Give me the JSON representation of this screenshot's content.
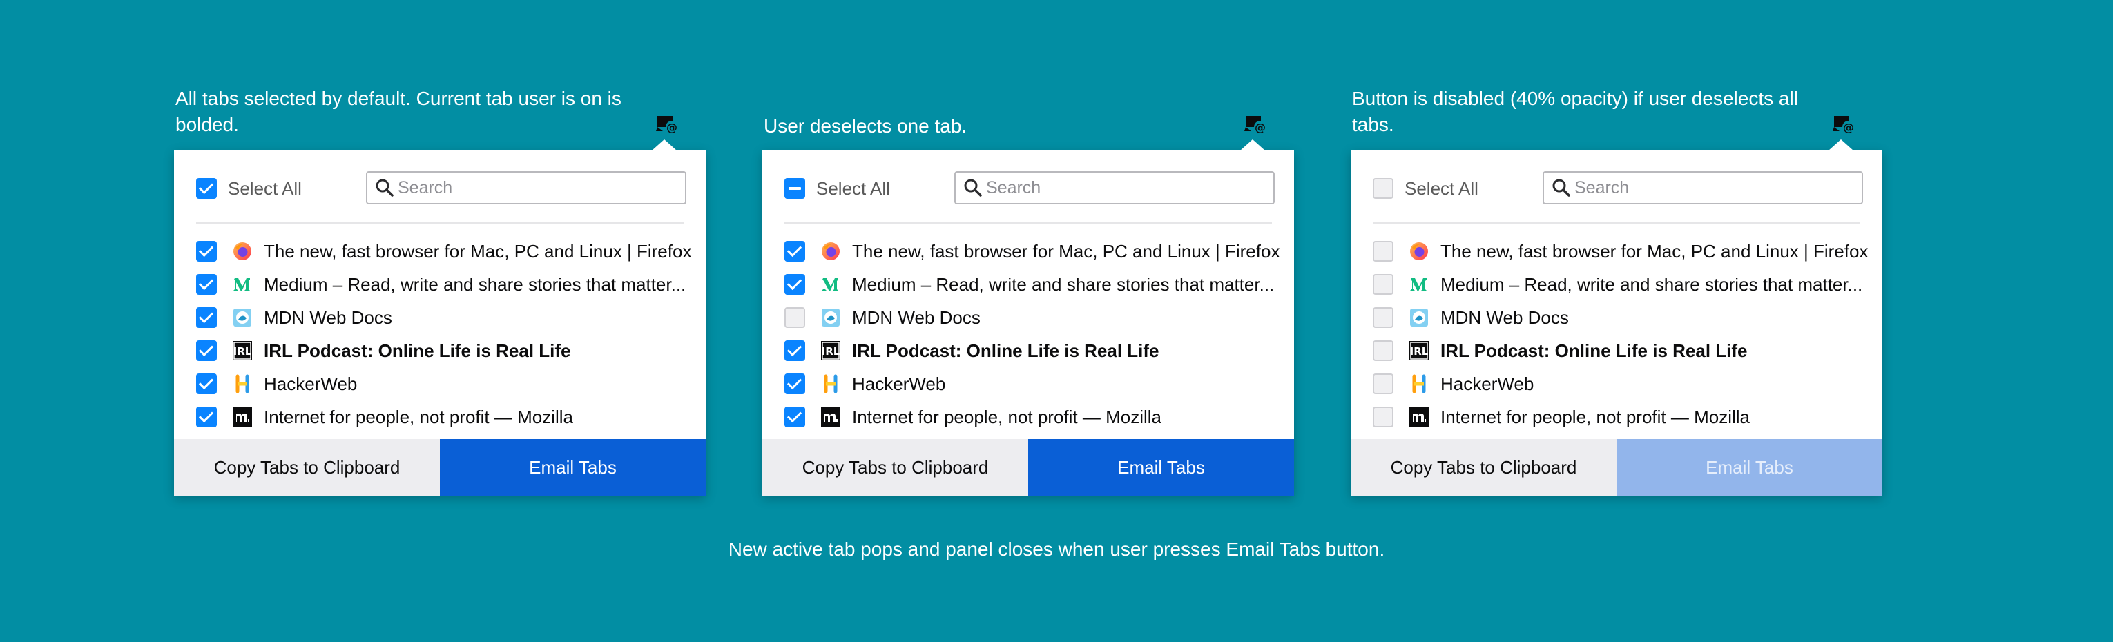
{
  "colors": {
    "background": "#028ea3",
    "accent_blue": "#0a84ff",
    "email_button": "#0a5fd6",
    "email_button_disabled": "#92b5eb"
  },
  "icons": {
    "toolbar": "email-tabs-icon",
    "search": "search-icon",
    "favicons": [
      "firefox-icon",
      "medium-icon",
      "mdn-icon",
      "irl-icon",
      "hackerweb-icon",
      "mozilla-icon"
    ]
  },
  "panels": [
    {
      "caption": "All tabs selected by default. Current tab user is on is bolded.",
      "select_all_label": "Select All",
      "select_all_state": "checked",
      "search_placeholder": "Search",
      "tabs": [
        {
          "title": "The new, fast browser for Mac, PC and Linux | Firefox",
          "checked": true,
          "bold": false
        },
        {
          "title": "Medium – Read, write and share stories that matter...",
          "checked": true,
          "bold": false
        },
        {
          "title": "MDN Web Docs",
          "checked": true,
          "bold": false
        },
        {
          "title": "IRL Podcast: Online Life is Real Life",
          "checked": true,
          "bold": true
        },
        {
          "title": "HackerWeb",
          "checked": true,
          "bold": false
        },
        {
          "title": "Internet for people, not profit — Mozilla",
          "checked": true,
          "bold": false
        }
      ],
      "copy_label": "Copy Tabs to Clipboard",
      "email_label": "Email Tabs",
      "email_disabled": false
    },
    {
      "caption": "User deselects one tab.",
      "select_all_label": "Select All",
      "select_all_state": "indeterminate",
      "search_placeholder": "Search",
      "tabs": [
        {
          "title": "The new, fast browser for Mac, PC and Linux | Firefox",
          "checked": true,
          "bold": false
        },
        {
          "title": "Medium – Read, write and share stories that matter...",
          "checked": true,
          "bold": false
        },
        {
          "title": "MDN Web Docs",
          "checked": false,
          "bold": false
        },
        {
          "title": "IRL Podcast: Online Life is Real Life",
          "checked": true,
          "bold": true
        },
        {
          "title": "HackerWeb",
          "checked": true,
          "bold": false
        },
        {
          "title": "Internet for people, not profit — Mozilla",
          "checked": true,
          "bold": false
        }
      ],
      "copy_label": "Copy Tabs to Clipboard",
      "email_label": "Email Tabs",
      "email_disabled": false
    },
    {
      "caption": "Button is disabled (40% opacity) if user deselects all tabs.",
      "select_all_label": "Select All",
      "select_all_state": "unchecked",
      "search_placeholder": "Search",
      "tabs": [
        {
          "title": "The new, fast browser for Mac, PC and Linux | Firefox",
          "checked": false,
          "bold": false
        },
        {
          "title": "Medium – Read, write and share stories that matter...",
          "checked": false,
          "bold": false
        },
        {
          "title": "MDN Web Docs",
          "checked": false,
          "bold": false
        },
        {
          "title": "IRL Podcast: Online Life is Real Life",
          "checked": false,
          "bold": true
        },
        {
          "title": "HackerWeb",
          "checked": false,
          "bold": false
        },
        {
          "title": "Internet for people, not profit — Mozilla",
          "checked": false,
          "bold": false
        }
      ],
      "copy_label": "Copy Tabs to Clipboard",
      "email_label": "Email Tabs",
      "email_disabled": true
    }
  ],
  "bottom_note": "New active tab pops and panel closes when user presses Email Tabs button."
}
